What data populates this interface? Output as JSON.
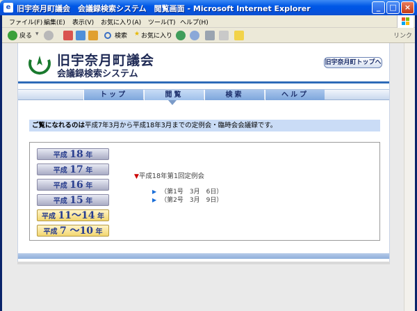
{
  "window": {
    "title": "旧宇奈月町議会　会議録検索システム　閲覧画面 - Microsoft Internet Explorer",
    "buttons": [
      "_",
      "□",
      "×"
    ]
  },
  "menu": {
    "items": [
      "ファイル(F)",
      "編集(E)",
      "表示(V)",
      "お気に入り(A)",
      "ツール(T)",
      "ヘルプ(H)"
    ]
  },
  "toolbar": {
    "back_label": "戻る",
    "search_label": "検索",
    "favorites_label": "お気に入り",
    "links_label": "リンク"
  },
  "header": {
    "site_title": "旧宇奈月町議会",
    "site_subtitle": "会議録検索システム",
    "top_link": "旧宇奈月町トップへ"
  },
  "nav": {
    "tabs": [
      "トップ",
      "閲覧",
      "検索",
      "ヘルプ"
    ],
    "active": "閲覧"
  },
  "notice": {
    "lead": "ご覧になれるのは",
    "rest": "平成7年3月から平成18年3月までの定例会・臨時会会議録です。"
  },
  "years": [
    {
      "prefix": "平成",
      "year": "18",
      "suffix": "年"
    },
    {
      "prefix": "平成",
      "year": "17",
      "suffix": "年"
    },
    {
      "prefix": "平成",
      "year": "16",
      "suffix": "年"
    },
    {
      "prefix": "平成",
      "year": "15",
      "suffix": "年"
    },
    {
      "prefix": "平成",
      "year": "11～14",
      "suffix": "年"
    },
    {
      "prefix": "平成",
      "year": "7 ～10",
      "suffix": "年"
    }
  ],
  "session": {
    "marker": "▼",
    "title": "平成18年第1回定例会",
    "issues": [
      "（第1号　3月　6日）",
      "（第2号　3月　9日）"
    ]
  },
  "colors": {
    "title_bar": "#0054e3",
    "header_rule": "#2e6bb8",
    "notice_bg": "#cadcf6",
    "gold_button": "#f2d66f",
    "silver_button": "#a9acc4"
  }
}
